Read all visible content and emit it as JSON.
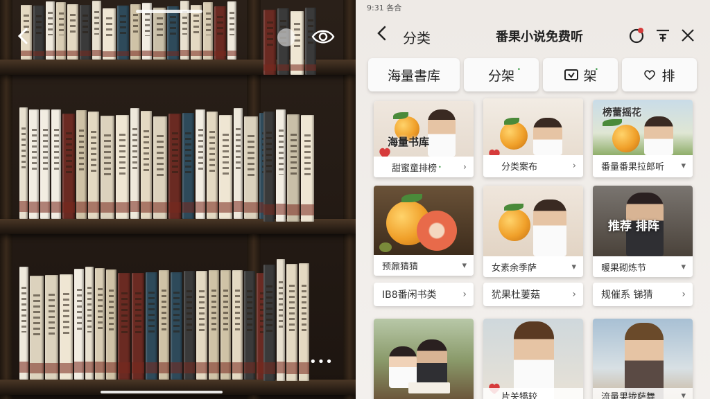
{
  "left": {
    "icons": {
      "back": "chevron-left-icon",
      "view": "eye-icon",
      "more": "more-dots-icon"
    },
    "more_label": "•••"
  },
  "status_bar": {
    "time": "9:31 各合"
  },
  "nav": {
    "back_glyph": "<",
    "category": "分类",
    "title": "番果小说免费听",
    "icons": [
      "record-icon",
      "filter-icon",
      "close-icon"
    ]
  },
  "tabs": [
    {
      "label": "海量書库",
      "sup": ""
    },
    {
      "label": "分架",
      "sup": "•"
    },
    {
      "label": "架",
      "sup": "•",
      "icon": "bookmark-icon"
    },
    {
      "label": "排",
      "sup": "",
      "icon": "heart-icon"
    }
  ],
  "cards": [
    {
      "overlay": "海量书库",
      "footer": "甜蜜童排榜",
      "sup": "•"
    },
    {
      "overlay": "",
      "footer": "分类案布",
      "sup": ""
    },
    {
      "overlay": "榜蕾摇花",
      "footer": "番量番果拉郎听",
      "sup": ""
    },
    {
      "overlay": "",
      "footer": "预鼐猜猜",
      "sup": ""
    },
    {
      "overlay": "",
      "footer": "女素余季萨",
      "sup": ""
    },
    {
      "overlay": "推荐 排阵",
      "footer": "暖果砌炼节",
      "sup": ""
    },
    {
      "overlay": "",
      "footer": "",
      "sup": ""
    },
    {
      "overlay": "",
      "footer": "片关犞较",
      "sup": ""
    },
    {
      "overlay": "",
      "footer": "流量果拢萨舞",
      "sup": ""
    }
  ],
  "pill_rows": [
    "IB8番闲书类",
    "犹果杜萋菇",
    "规催系 锑猜"
  ],
  "colors": {
    "accent_red": "#d63b3b",
    "green_dot": "#3c9a4a"
  }
}
